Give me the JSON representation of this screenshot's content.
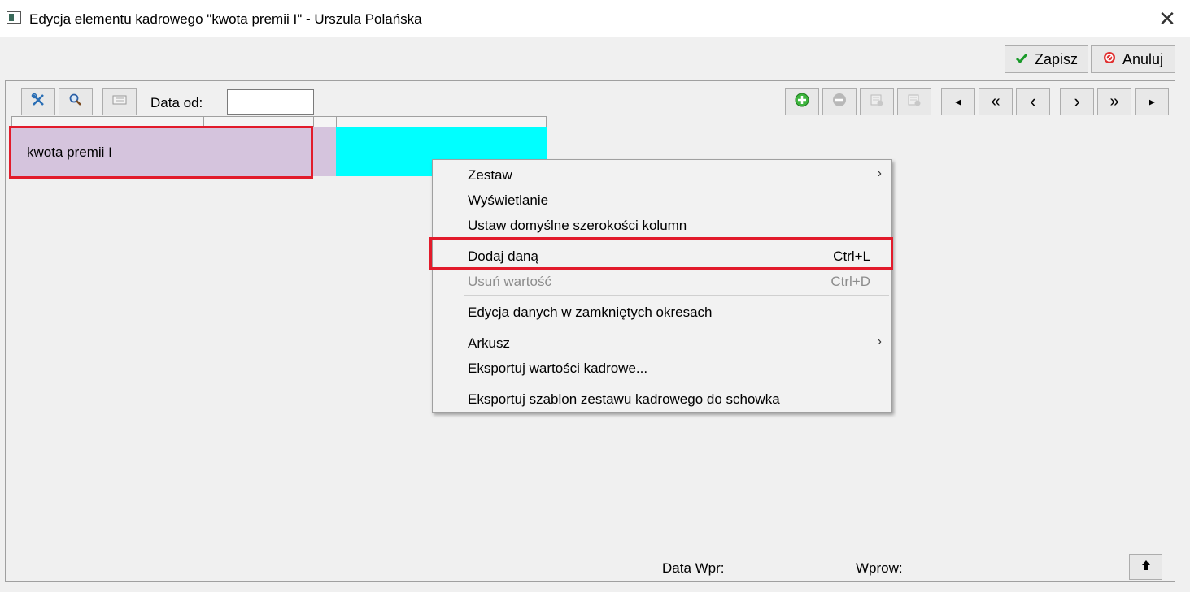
{
  "window": {
    "title": "Edycja elementu kadrowego \"kwota premii I\" - Urszula Polańska",
    "close_glyph": "✕"
  },
  "actions": {
    "save_label": "Zapisz",
    "cancel_label": "Anuluj"
  },
  "toolbar": {
    "date_from_label": "Data od:",
    "date_from_value": ""
  },
  "nav_buttons": [
    "◂",
    "«",
    "‹",
    "›",
    "»",
    "▸"
  ],
  "grid": {
    "row_label": "kwota premii I",
    "colors": {
      "row": "#d5c4dd",
      "value_cell": "#00ffff",
      "highlight": "#e21b2b"
    }
  },
  "context_menu": {
    "items": [
      {
        "label": "Zestaw",
        "shortcut": "",
        "submenu": true,
        "enabled": true
      },
      {
        "label": "Wyświetlanie",
        "shortcut": "",
        "submenu": false,
        "enabled": true
      },
      {
        "label": "Ustaw domyślne szerokości kolumn",
        "shortcut": "",
        "submenu": false,
        "enabled": true
      },
      {
        "label": "Dodaj daną",
        "shortcut": "Ctrl+L",
        "submenu": false,
        "enabled": true
      },
      {
        "label": "Usuń wartość",
        "shortcut": "Ctrl+D",
        "submenu": false,
        "enabled": false
      },
      {
        "label": "Edycja danych w zamkniętych okresach",
        "shortcut": "",
        "submenu": false,
        "enabled": true
      },
      {
        "label": "Arkusz",
        "shortcut": "",
        "submenu": true,
        "enabled": true
      },
      {
        "label": "Eksportuj wartości kadrowe...",
        "shortcut": "",
        "submenu": false,
        "enabled": true
      },
      {
        "label": "Eksportuj szablon zestawu kadrowego do schowka",
        "shortcut": "",
        "submenu": false,
        "enabled": true
      }
    ],
    "submenu_arrow": "›"
  },
  "footer": {
    "data_wpr_label": "Data Wpr:",
    "wprow_label": "Wprow:",
    "up_glyph": "🡅"
  }
}
